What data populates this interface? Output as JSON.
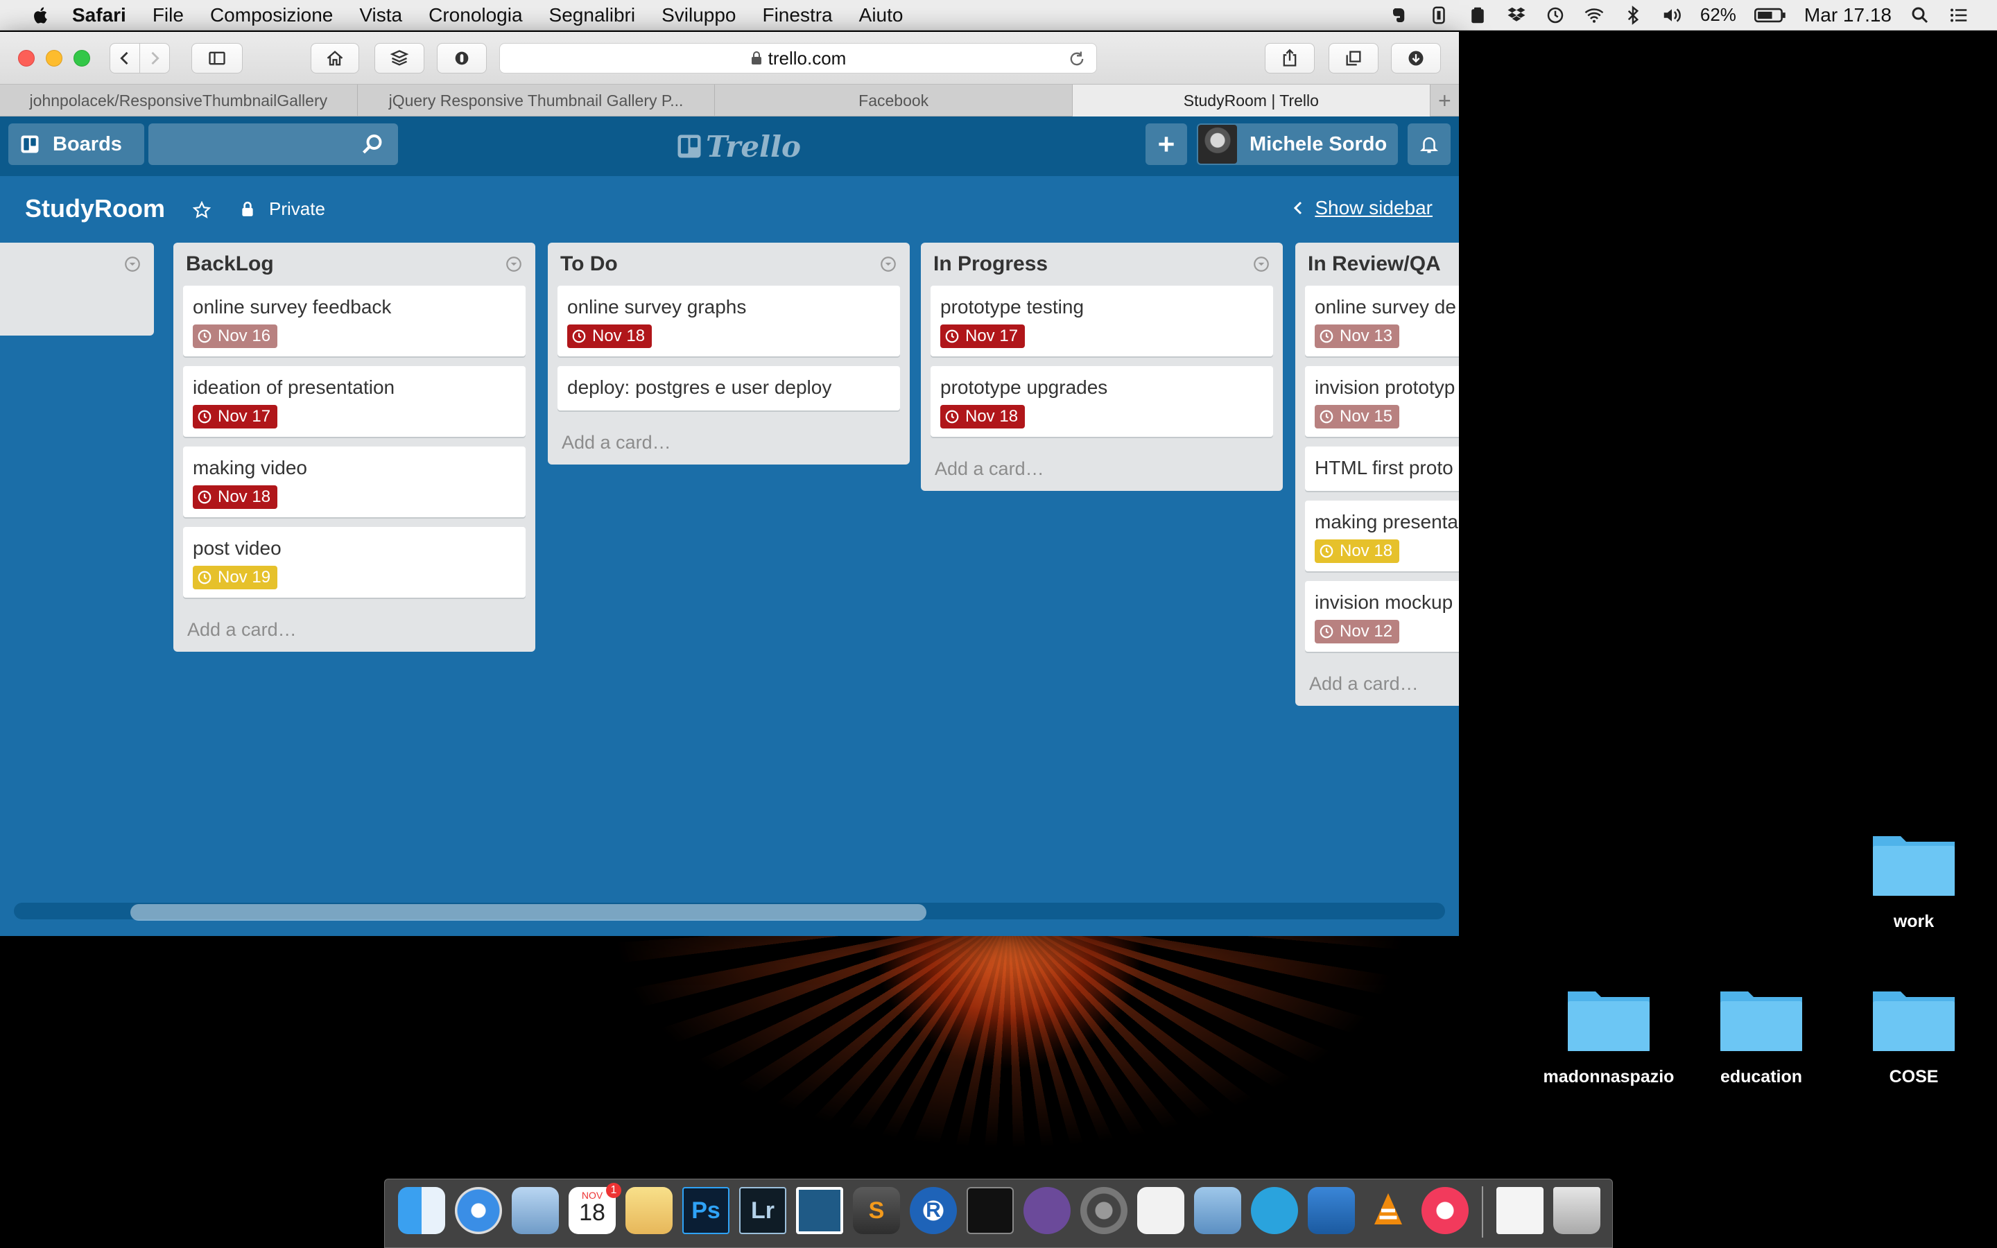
{
  "menubar": {
    "app_name": "Safari",
    "items": [
      "File",
      "Composizione",
      "Vista",
      "Cronologia",
      "Segnalibri",
      "Sviluppo",
      "Finestra",
      "Aiuto"
    ],
    "battery": "62%",
    "clock": "Mar 17.18"
  },
  "browser": {
    "url": "trello.com",
    "tabs": [
      {
        "title": "johnpolacek/ResponsiveThumbnailGallery"
      },
      {
        "title": "jQuery Responsive Thumbnail Gallery P..."
      },
      {
        "title": "Facebook"
      },
      {
        "title": "StudyRoom | Trello"
      }
    ]
  },
  "trello": {
    "boards_label": "Boards",
    "search_placeholder": "",
    "logo_text": "Trello",
    "member_name": "Michele Sordo"
  },
  "board": {
    "title": "StudyRoom",
    "privacy": "Private",
    "show_sidebar": "Show sidebar",
    "add_card_label": "Add a card…",
    "lists": [
      {
        "name": "BackLog",
        "cards": [
          {
            "title": "online survey feedback",
            "due": "Nov 16",
            "status": "past"
          },
          {
            "title": "ideation of presentation",
            "due": "Nov 17",
            "status": "overdue"
          },
          {
            "title": "making video",
            "due": "Nov 18",
            "status": "overdue"
          },
          {
            "title": "post video",
            "due": "Nov 19",
            "status": "soon"
          }
        ]
      },
      {
        "name": "To Do",
        "cards": [
          {
            "title": "online survey graphs",
            "due": "Nov 18",
            "status": "overdue"
          },
          {
            "title": "deploy: postgres e user deploy",
            "due": null,
            "status": null
          }
        ]
      },
      {
        "name": "In Progress",
        "cards": [
          {
            "title": "prototype testing",
            "due": "Nov 17",
            "status": "overdue"
          },
          {
            "title": "prototype upgrades",
            "due": "Nov 18",
            "status": "overdue"
          }
        ]
      },
      {
        "name": "In Review/QA",
        "cards": [
          {
            "title": "online survey de",
            "due": "Nov 13",
            "status": "past"
          },
          {
            "title": "invision prototyp",
            "due": "Nov 15",
            "status": "past"
          },
          {
            "title": "HTML first proto",
            "due": null,
            "status": null
          },
          {
            "title": "making presenta",
            "due": "Nov 18",
            "status": "soon"
          },
          {
            "title": "invision mockup",
            "due": "Nov 12",
            "status": "past"
          }
        ]
      }
    ]
  },
  "colors": {
    "board_bg": "#1b6ea8",
    "header_bg": "#0c5a8c",
    "due_overdue": "#b0161a",
    "due_past": "#b88180",
    "due_soon": "#e6c12b",
    "folder": "#6cc6f4"
  },
  "desktop": {
    "folders": [
      "work",
      "madonnaspazio",
      "education",
      "COSE"
    ]
  },
  "dock": {
    "calendar_month": "NOV",
    "calendar_day": "18",
    "calendar_badge": "1",
    "icons": [
      "finder-icon",
      "safari-icon",
      "mail-icon",
      "calendar-icon",
      "notes-icon",
      "photoshop-icon",
      "lightroom-icon",
      "brackets-icon",
      "sublime-icon",
      "r-icon",
      "terminal-icon",
      "github-icon",
      "system-preferences-icon",
      "textedit-icon",
      "preview-icon",
      "telegram-icon",
      "keynote-icon",
      "vlc-icon",
      "itunes-icon",
      "avi-file-icon",
      "trash-icon"
    ],
    "ps_label": "Ps",
    "lr_label": "Lr",
    "r_label": "R"
  }
}
